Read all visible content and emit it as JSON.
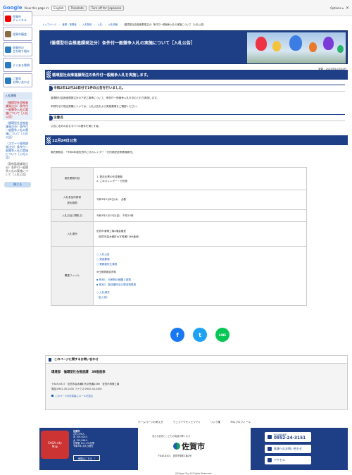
{
  "translate_bar": {
    "logo": "Google",
    "prompt": "View this page in:",
    "language": "English",
    "translate_button": "Translate",
    "turn_off_button": "Turn off for: Japanese",
    "options": "Options ▾",
    "close": "✕"
  },
  "sidebar": {
    "buttons": [
      {
        "label": "佐賀市\nチャンネル",
        "icon": "youtube-icon",
        "color": "#e00"
      },
      {
        "label": "佐賀市議会",
        "icon": "city-hall-icon",
        "color": "#8b6d45"
      },
      {
        "label": "佐賀市の\n主な取り組み",
        "icon": "initiatives-icon",
        "color": "#2a7bc0"
      },
      {
        "label": "よくある質問",
        "icon": "question-icon",
        "color": "#2a7bc0"
      },
      {
        "label": "ご意見\nお問い合わせ",
        "icon": "mail-icon",
        "color": "#2a7bc0"
      }
    ],
    "section_title": "入札情報",
    "links": [
      "（循環型社会推進課発注分）条件付一般競争入札の実施について［入札公告］",
      "（循環型社会推進課発注分）条件付一般競争入札の実施について［入札公告］",
      "（スポーツ振興課発注分）条件付一般競争入札の実施について［入札公告］",
      "（契約監理課発注分）条件付一般競争入札の実施について［入札公告］"
    ],
    "close_label": "閉じる"
  },
  "breadcrumb": [
    "トップページ",
    "産業・事業者",
    "入札契約",
    "入札",
    "入札情報",
    "（循環型社会推進課発注分）条件付一般競争入札の実施について［入札公告］"
  ],
  "page_title": "（循環型社会推進課発注分）条件付一般競争入札の実施について［入札公告］",
  "updated": "更新：2020年12月24日",
  "section1": {
    "heading": "循環型社会推進課発注の条件付一般競争入札を実施します。",
    "sub_heading": "令和2年12月24日付で1件の公告を行いました。",
    "paragraphs": [
      "循環型社会推進課発注分の下記工事等について、条件付一般競争入札を次のとおり実施します。",
      "申請方法や提出書類については、入札公告および実施要領をご確認ください。"
    ],
    "note_heading": "注意点",
    "note_text": "公告に定めのあるすべての要件を満たす者。"
  },
  "section2": {
    "heading": "12月24日公告",
    "intro": "委託業務名　「令和3年度佐賀市ごみカレンダー・分別表配送等業務委託」",
    "table": {
      "rows": [
        {
          "label": "委託業務内容",
          "values": [
            "1. 配送伝票の作成業務",
            "2. ごみカレンダー・分別表"
          ]
        },
        {
          "label": "入札参加申請書\n提出期限",
          "values": [
            "令和3年1月6日(水)　必着"
          ]
        },
        {
          "label": "入札日及び開札日",
          "values": [
            "令和3年1月15日(金)　午前10時"
          ]
        },
        {
          "label": "入札場所",
          "values": [
            "佐賀市清掃工場2階会議室",
            "（佐賀市高木瀬町大字長瀬2369番地）"
          ]
        }
      ],
      "files_label": "関連ファイル",
      "files": [
        {
          "text": "入札公告",
          "kind": "pdf"
        },
        {
          "text": "実施要領",
          "kind": "pdf"
        },
        {
          "text": "業務委託仕様書",
          "kind": "pdf"
        },
        {
          "text": "※仕様書補足資料",
          "kind": "note"
        },
        {
          "text": "別添1　印刷物の種類と部数",
          "kind": "excel"
        },
        {
          "text": "別添2　配送箇所及び配送物数数",
          "kind": "excel"
        },
        {
          "text": "入札様式",
          "kind": "pdf"
        },
        {
          "text": "（記入例）",
          "kind": "plain"
        }
      ]
    }
  },
  "social": [
    {
      "name": "facebook",
      "glyph": "f",
      "color": "#1877f2"
    },
    {
      "name": "twitter",
      "glyph": "t",
      "color": "#1da1f2"
    },
    {
      "name": "line",
      "glyph": "LINE",
      "color": "#06c755"
    }
  ],
  "contact": {
    "heading": "このページに関するお問い合わせ",
    "dept": "環境部　循環型社会推進課　3R推進係",
    "address": "〒849-0917　佐賀市高木瀬町大字長瀬2369　佐賀市清掃工場",
    "phone": "電話:0952-30-2430 ファクス:0952-30-2494",
    "mail_link": "このページの作成者にメールを送る"
  },
  "footer_links": [
    "ホームページの考え方",
    "ウェブアクセシビリティ",
    "リンク集",
    "市のプロフィール"
  ],
  "footer": {
    "map_label": "SAGA city\nMap",
    "info_title": "佐賀市",
    "info_lines": [
      "233,376人",
      "男 109,400人",
      "女 123,966人",
      "世帯数 101,731世帯",
      "令和3年1月1日現在"
    ],
    "access_button": "地図はこちら",
    "tagline": "豊かな自然とこどもの笑顔が輝くまち",
    "logo_text": "佐賀市",
    "address": "〒840-8501　佐賀市栄町1番1号",
    "phone_label": "代表電話番号",
    "phone": "0952-24-3151",
    "inquiry_label": "各課へのお問い合わせ",
    "access_label": "アクセス"
  },
  "copyright": "(C)Saga City All Rights Reserved."
}
